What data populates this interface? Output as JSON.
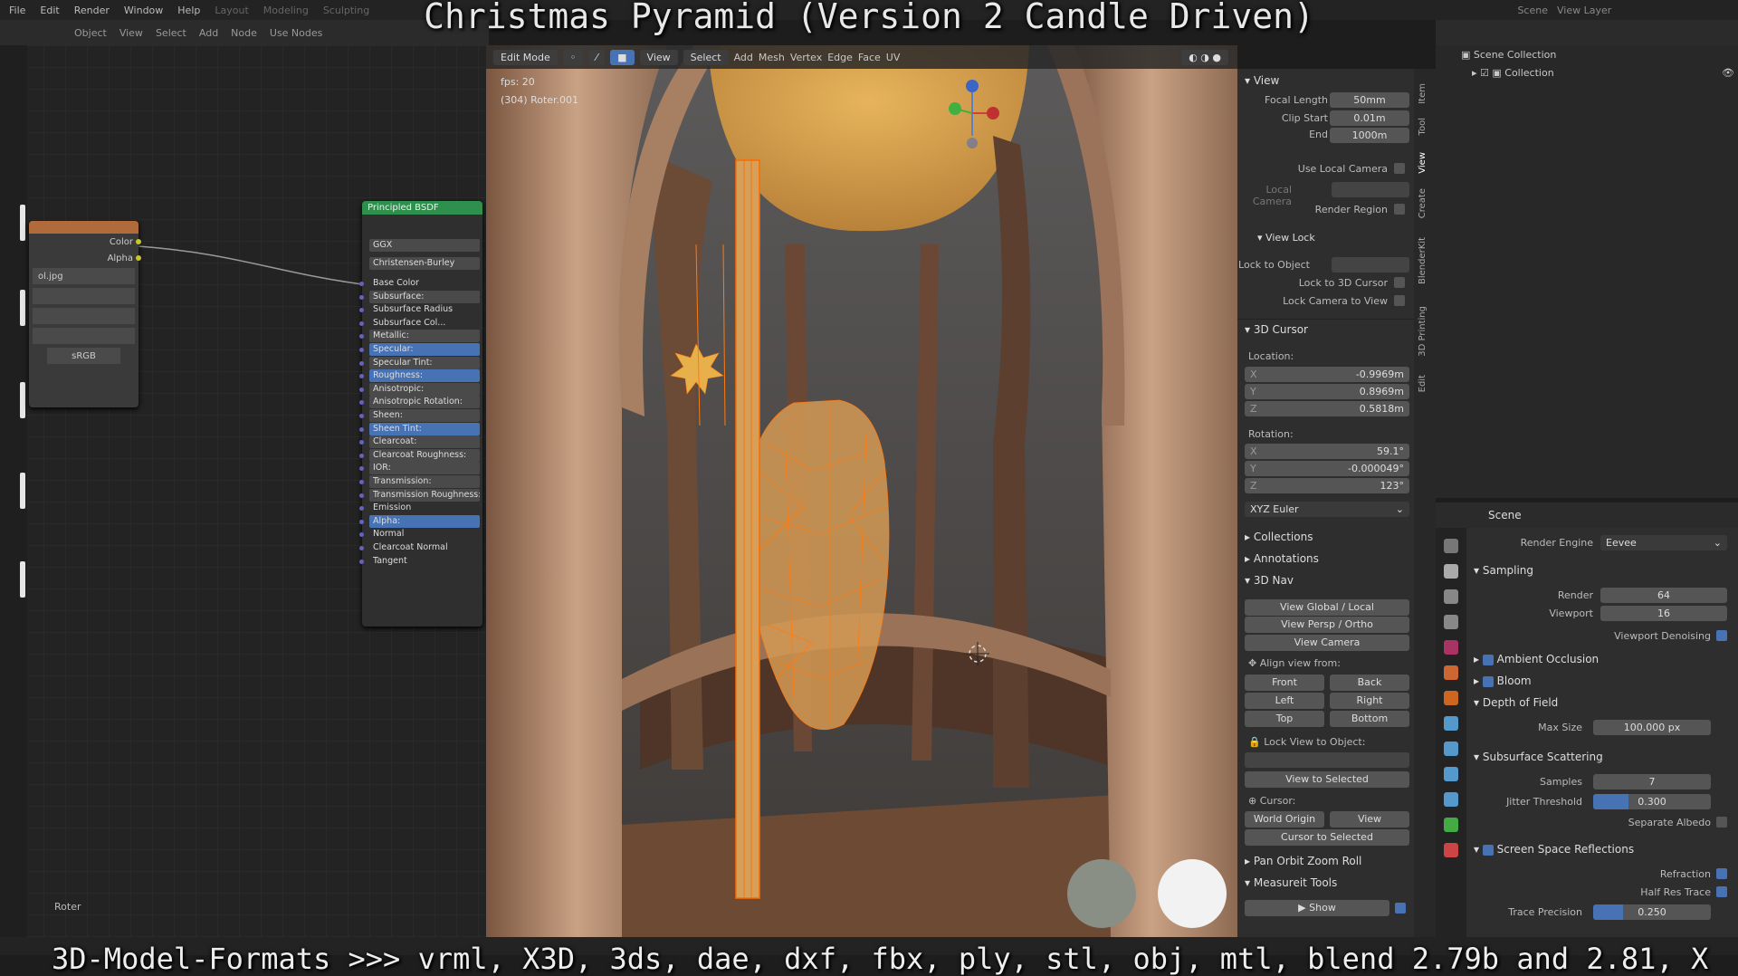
{
  "overlay": {
    "title": "Christmas Pyramid (Version 2 Candle Driven)",
    "footer": "3D-Model-Formats >>> vrml, X3D, 3ds, dae, dxf, fbx, ply, stl, obj, mtl, blend 2.79b and 2.81, X"
  },
  "topbar": {
    "menus": [
      "File",
      "Edit",
      "Render",
      "Window",
      "Help"
    ],
    "workspaces": [
      "Layout",
      "Modeling",
      "Sculpting"
    ],
    "scene": "Scene",
    "view_layer": "View Layer"
  },
  "node_toolbar": {
    "mode": "Object",
    "items": [
      "View",
      "Select",
      "Add",
      "Node"
    ],
    "use_nodes": "Use Nodes"
  },
  "image_node": {
    "outputs": [
      "Color",
      "Alpha"
    ],
    "file": "ol.jpg",
    "colorspace": "sRGB"
  },
  "bsdf_node": {
    "title": "Principled BSDF",
    "distribution": "GGX",
    "subsurface_method": "Christensen-Burley",
    "inputs": [
      {
        "label": "Base Color",
        "style": "plain"
      },
      {
        "label": "Subsurface:",
        "style": "grey"
      },
      {
        "label": "Subsurface Radius",
        "style": "plain"
      },
      {
        "label": "Subsurface Col...",
        "style": "plain"
      },
      {
        "label": "Metallic:",
        "style": "grey"
      },
      {
        "label": "Specular:",
        "style": "blue"
      },
      {
        "label": "Specular Tint:",
        "style": "grey"
      },
      {
        "label": "Roughness:",
        "style": "blue"
      },
      {
        "label": "Anisotropic:",
        "style": "grey"
      },
      {
        "label": "Anisotropic Rotation:",
        "style": "grey"
      },
      {
        "label": "Sheen:",
        "style": "grey"
      },
      {
        "label": "Sheen Tint:",
        "style": "blue"
      },
      {
        "label": "Clearcoat:",
        "style": "grey"
      },
      {
        "label": "Clearcoat Roughness:",
        "style": "grey"
      },
      {
        "label": "IOR:",
        "style": "grey"
      },
      {
        "label": "Transmission:",
        "style": "grey"
      },
      {
        "label": "Transmission Roughness:",
        "style": "grey"
      },
      {
        "label": "Emission",
        "style": "plain"
      },
      {
        "label": "Alpha:",
        "style": "blue"
      },
      {
        "label": "Normal",
        "style": "plain"
      },
      {
        "label": "Clearcoat Normal",
        "style": "plain"
      },
      {
        "label": "Tangent",
        "style": "plain"
      }
    ]
  },
  "node_label": "Roter",
  "viewport": {
    "mode": "Edit Mode",
    "menus": [
      "View",
      "Select",
      "Add",
      "Mesh",
      "Vertex",
      "Edge",
      "Face",
      "UV"
    ],
    "fps": "fps: 20",
    "object": "(304) Roter.001"
  },
  "npanel": {
    "tabs": [
      "Item",
      "Tool",
      "View",
      "Create",
      "BlenderKit",
      "3D Printing",
      "Edit"
    ],
    "view": {
      "title": "View",
      "focal_length_label": "Focal Length",
      "focal_length": "50mm",
      "clip_start_label": "Clip Start",
      "clip_start": "0.01m",
      "end_label": "End",
      "end": "1000m",
      "use_local_camera": "Use Local Camera",
      "local_camera": "Local Camera",
      "render_region": "Render Region"
    },
    "view_lock": {
      "title": "View Lock",
      "lock_to_object": "Lock to Object",
      "lock_to_cursor": "Lock to 3D Cursor",
      "lock_camera": "Lock Camera to View"
    },
    "cursor": {
      "title": "3D Cursor",
      "location": "Location:",
      "x": "-0.9969m",
      "y": "0.8969m",
      "z": "0.5818m",
      "rotation": "Rotation:",
      "rx": "59.1°",
      "ry": "-0.000049°",
      "rz": "123°",
      "mode": "XYZ Euler"
    },
    "collections": "Collections",
    "annotations": "Annotations",
    "nav": {
      "title": "3D Nav",
      "global_local": "View Global / Local",
      "persp_ortho": "View Persp / Ortho",
      "camera": "View Camera",
      "align": "Align view from:",
      "front": "Front",
      "back": "Back",
      "left": "Left",
      "right": "Right",
      "top": "Top",
      "bottom": "Bottom",
      "lock_view": "Lock View to Object:",
      "view_selected": "View to Selected",
      "cursor": "Cursor:",
      "world_origin": "World Origin",
      "view": "View",
      "cursor_selected": "Cursor to Selected"
    },
    "pan_orbit": "Pan Orbit Zoom Roll",
    "measure": "Measureit Tools",
    "show": "Show"
  },
  "outliner": {
    "root": "Scene Collection",
    "child": "Collection"
  },
  "properties": {
    "header": "Scene",
    "render_engine_label": "Render Engine",
    "render_engine": "Eevee",
    "sampling": "Sampling",
    "render_label": "Render",
    "render": "64",
    "viewport_label": "Viewport",
    "viewport": "16",
    "denoise": "Viewport Denoising",
    "ao": "Ambient Occlusion",
    "bloom": "Bloom",
    "dof": "Depth of Field",
    "max_size_label": "Max Size",
    "max_size": "100.000 px",
    "sss": "Subsurface Scattering",
    "samples_label": "Samples",
    "samples": "7",
    "jitter_label": "Jitter Threshold",
    "jitter": "0.300",
    "jitter_fill": 0.3,
    "sep_albedo": "Separate Albedo",
    "ssr": "Screen Space Reflections",
    "refraction": "Refraction",
    "half_res": "Half Res Trace",
    "trace_label": "Trace Precision",
    "trace": "0.250",
    "trace_fill": 0.25
  },
  "colors": {
    "accent_blue": "#4772b3",
    "mesh_orange": "#e69a3c",
    "node_green": "#2f8f4c",
    "node_orange": "#b06a3c"
  }
}
